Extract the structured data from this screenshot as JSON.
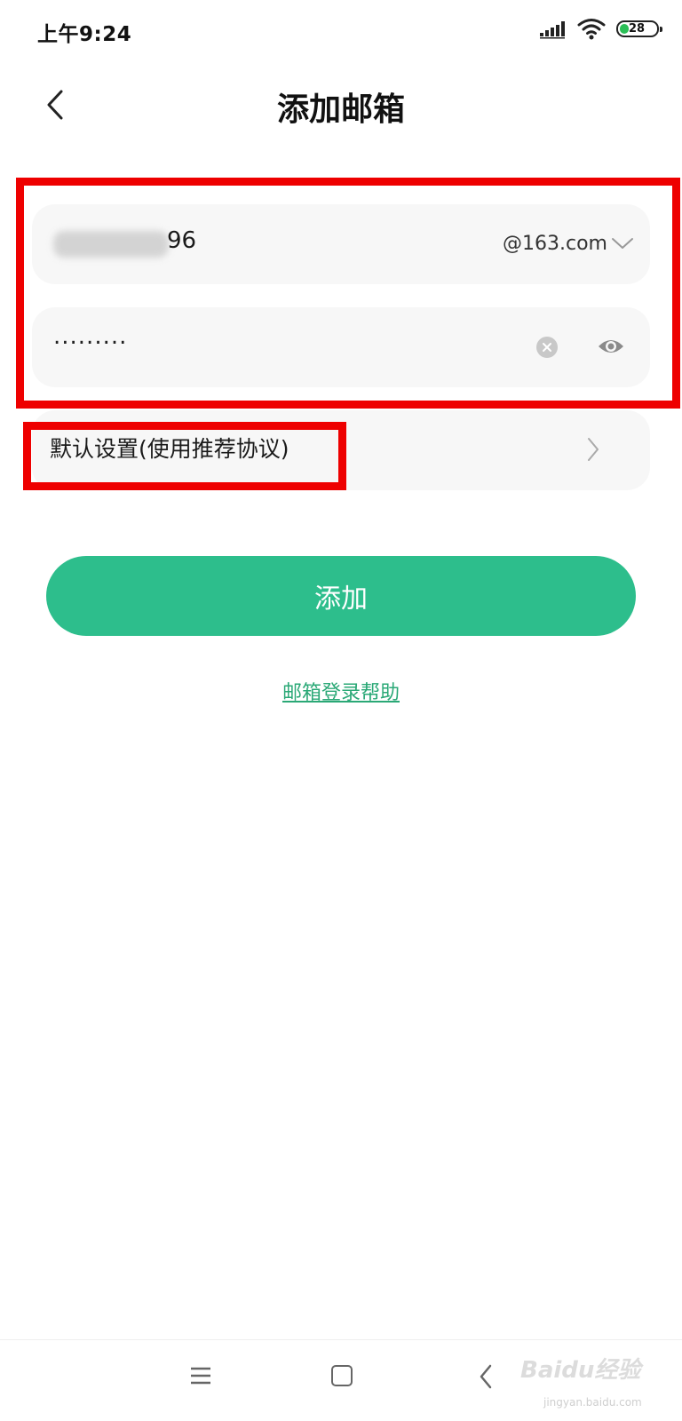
{
  "status_bar": {
    "time": "上午9:24",
    "battery": "28",
    "icons": [
      "signal-icon",
      "wifi-icon",
      "battery-icon"
    ]
  },
  "header": {
    "title": "添加邮箱",
    "back_icon": "chevron-left-icon"
  },
  "form": {
    "email_visible_suffix": "96",
    "email_domain": "@163.com",
    "password_masked": ".........",
    "settings_label": "默认设置(使用推荐协议)"
  },
  "actions": {
    "add_label": "添加",
    "help_link": "邮箱登录帮助"
  },
  "watermark": {
    "text": "Baidu经验",
    "sub": "jingyan.baidu.com"
  },
  "colors": {
    "accent": "#2dbe8c",
    "link": "#2aa876",
    "annotation": "#ee0000",
    "card_bg": "#f7f7f7"
  }
}
